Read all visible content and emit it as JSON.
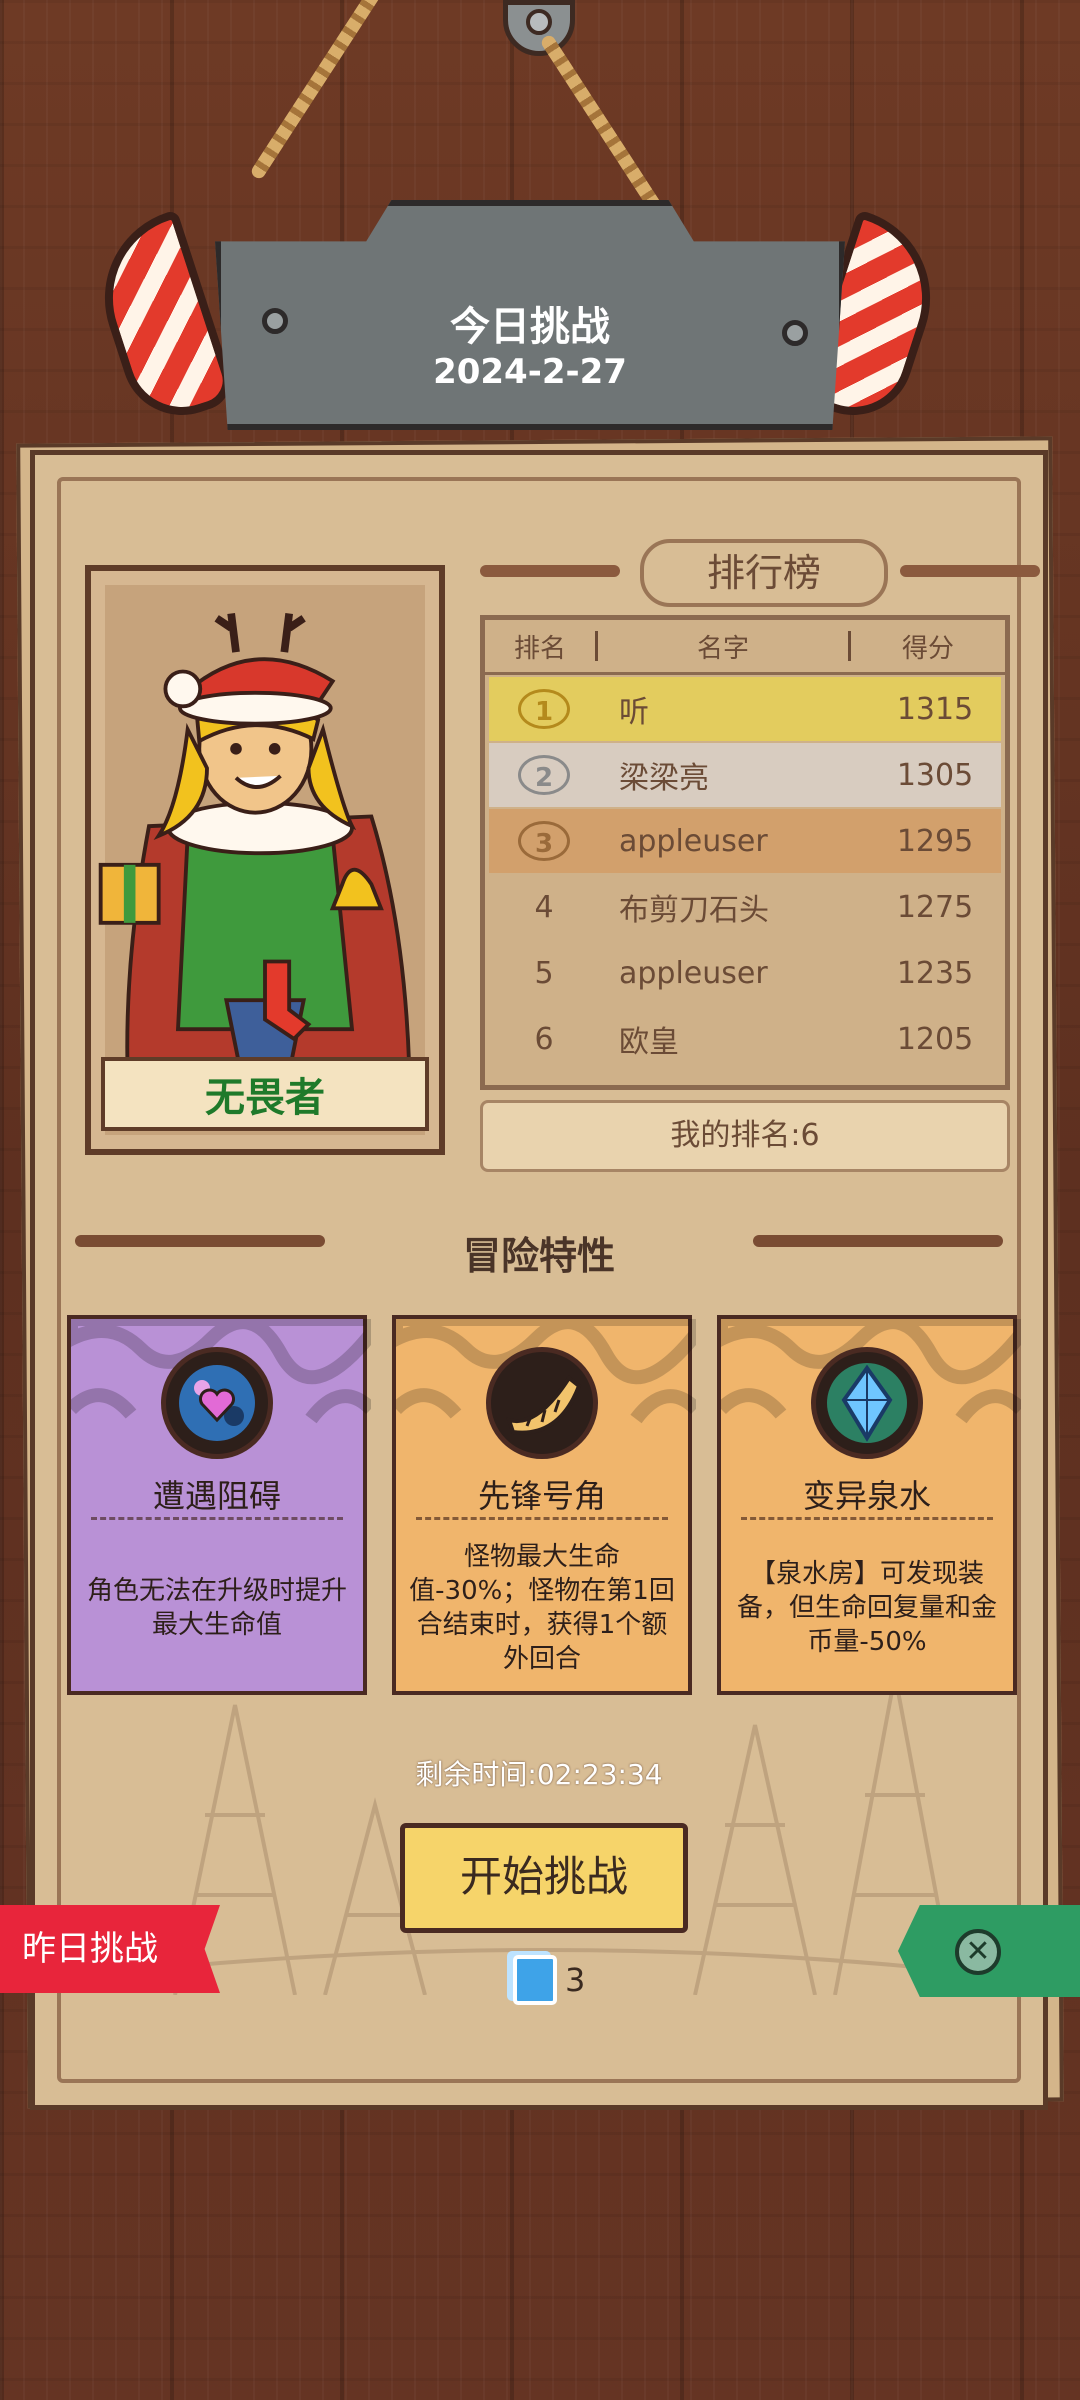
{
  "header": {
    "title": "今日挑战",
    "date": "2024-2-27"
  },
  "character": {
    "name": "无畏者"
  },
  "leaderboard": {
    "title": "排行榜",
    "columns": [
      "排名",
      "名字",
      "得分"
    ],
    "rows": [
      {
        "rank": "1",
        "name": "听",
        "score": "1315",
        "highlight": "#e3cc5e"
      },
      {
        "rank": "2",
        "name": "梁梁亮",
        "score": "1305",
        "highlight": "#d8ccc0"
      },
      {
        "rank": "3",
        "name": "appleuser",
        "score": "1295",
        "highlight": "#d2a06c"
      },
      {
        "rank": "4",
        "name": "布剪刀石头",
        "score": "1275",
        "highlight": ""
      },
      {
        "rank": "5",
        "name": "appleuser",
        "score": "1235",
        "highlight": ""
      },
      {
        "rank": "6",
        "name": "欧皇",
        "score": "1205",
        "highlight": ""
      }
    ],
    "my_rank": "我的排名:6"
  },
  "traits": {
    "title": "冒险特性",
    "cards": [
      {
        "name": "遭遇阻碍",
        "description": "角色无法在升级时提升最大生命值",
        "icon": "heart-orb-icon",
        "color": "#b991d6",
        "wave": "#8a5aa8"
      },
      {
        "name": "先锋号角",
        "description": "怪物最大生命值-30%；怪物在第1回合结束时，获得1个额外回合",
        "icon": "horn-icon",
        "color": "#f0b56c",
        "wave": "#d08a45"
      },
      {
        "name": "变异泉水",
        "description": "【泉水房】可发现装备，但生命回复量和金币量-50%",
        "icon": "crystal-icon",
        "color": "#f0b56c",
        "wave": "#d08a45"
      }
    ]
  },
  "timer": "剩余时间:02:23:34",
  "start_button": "开始挑战",
  "tickets": "3",
  "yesterday_button": "昨日挑战",
  "icons": {
    "exit": "exit-icon",
    "ticket": "ticket-icon"
  }
}
